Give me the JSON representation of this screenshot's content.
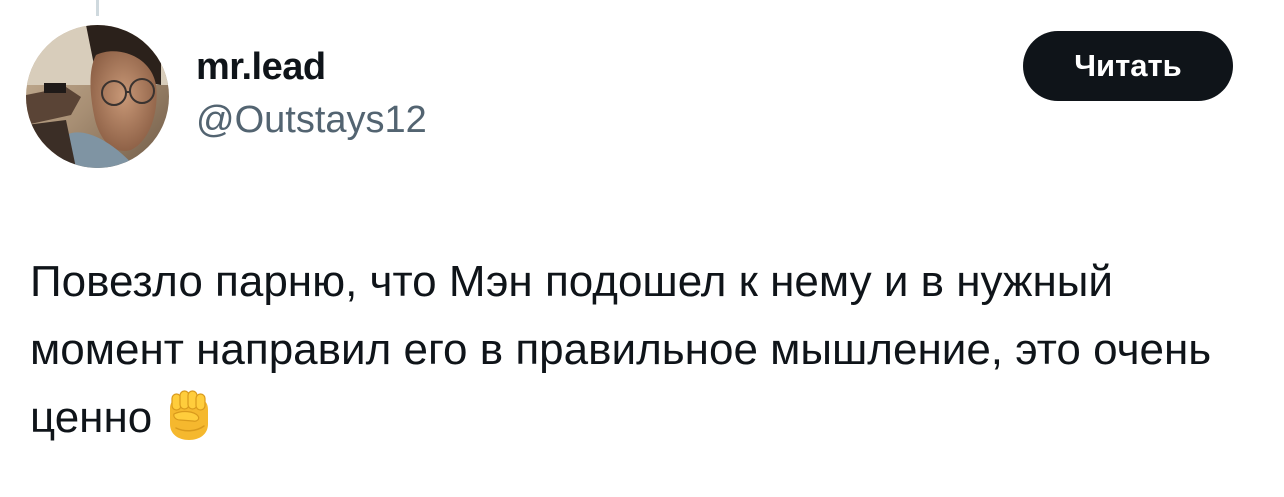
{
  "tweet": {
    "author": {
      "display_name": "mr.lead",
      "handle": "@Outstays12",
      "avatar_icon": "profile-photo-avatar"
    },
    "follow_button_label": "Читать",
    "text": "Повезло парню, что Мэн подошел к нему и в нужный момент направил его в правильное мышление, это очень ценно",
    "emoji_icon": "raised-fist-icon",
    "colors": {
      "text": "#0f1419",
      "secondary_text": "#536471",
      "button_bg": "#0f1419",
      "button_text": "#ffffff",
      "thread_line": "#cfd9de"
    }
  }
}
